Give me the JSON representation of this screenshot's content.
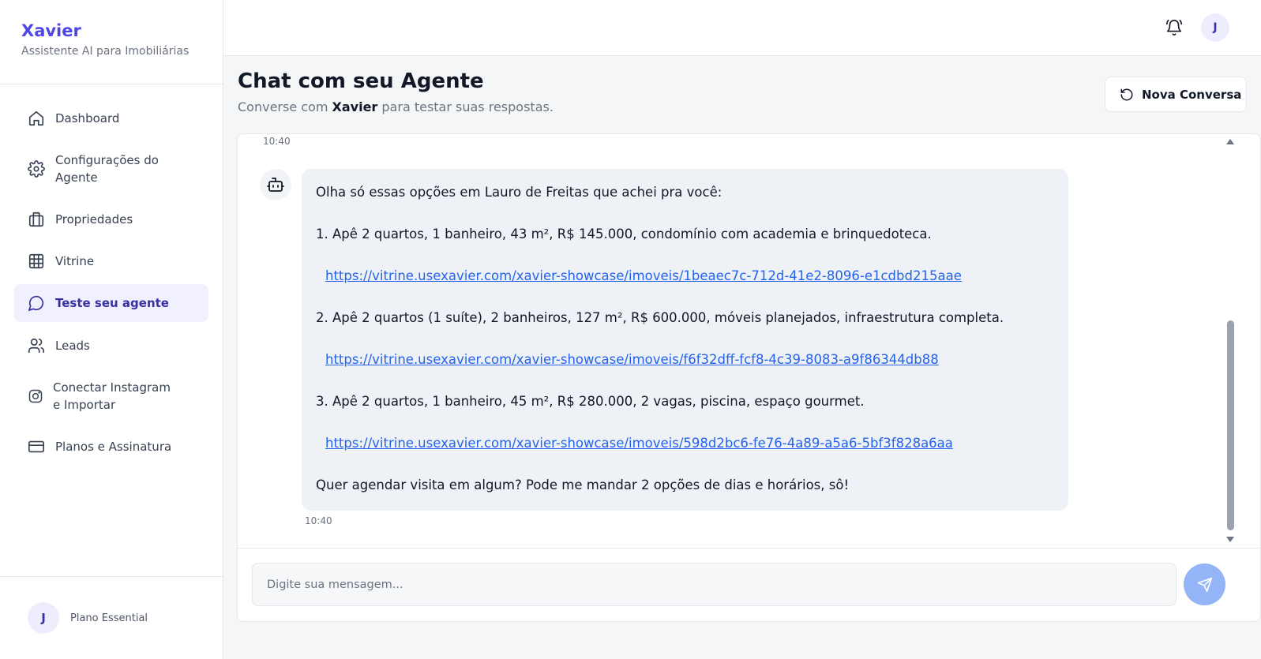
{
  "brand": {
    "name": "Xavier",
    "subtitle": "Assistente AI para Imobiliárias"
  },
  "sidebar": {
    "items": [
      {
        "label": "Dashboard",
        "icon": "home-icon"
      },
      {
        "label": "Configurações do Agente",
        "icon": "gear-icon"
      },
      {
        "label": "Propriedades",
        "icon": "building-icon"
      },
      {
        "label": "Vitrine",
        "icon": "grid-icon"
      },
      {
        "label": "Teste seu agente",
        "icon": "chat-bubble-icon",
        "active": true
      },
      {
        "label": "Leads",
        "icon": "users-icon"
      },
      {
        "label": "Conectar Instagram e Importar",
        "icon": "instagram-icon"
      },
      {
        "label": "Planos e Assinatura",
        "icon": "credit-card-icon"
      }
    ],
    "footer": {
      "avatar_initial": "J",
      "plan": "Plano Essential"
    }
  },
  "topbar": {
    "avatar_initial": "J"
  },
  "header": {
    "title": "Chat com seu Agente",
    "subtitle_prefix": "Converse com ",
    "subtitle_agent": "Xavier",
    "subtitle_suffix": " para testar suas respostas.",
    "new_chat_label": "Nova Conversa"
  },
  "chat": {
    "prev_timestamp": "10:40",
    "message": {
      "intro": "Olha só essas opções em Lauro de Freitas que achei pra você:",
      "options": [
        {
          "text": "1. Apê 2 quartos, 1 banheiro, 43 m², R$ 145.000, condomínio com academia e brinquedoteca.",
          "link": "https://vitrine.usexavier.com/xavier-showcase/imoveis/1beaec7c-712d-41e2-8096-e1cdbd215aae"
        },
        {
          "text": "2. Apê 2 quartos (1 suíte), 2 banheiros, 127 m², R$ 600.000, móveis planejados, infraestrutura completa.",
          "link": "https://vitrine.usexavier.com/xavier-showcase/imoveis/f6f32dff-fcf8-4c39-8083-a9f86344db88"
        },
        {
          "text": "3. Apê 2 quartos, 1 banheiro, 45 m², R$ 280.000, 2 vagas, piscina, espaço gourmet.",
          "link": "https://vitrine.usexavier.com/xavier-showcase/imoveis/598d2bc6-fe76-4a89-a5a6-5bf3f828a6aa"
        }
      ],
      "closing": "Quer agendar visita em algum? Pode me mandar 2 opções de dias e horários, sô!",
      "timestamp": "10:40"
    },
    "input_placeholder": "Digite sua mensagem..."
  },
  "colors": {
    "accent": "#4f46e5",
    "active_bg": "#f1f0fe",
    "link": "#2563eb",
    "send_button": "#93b4f7",
    "bubble_bg": "#eef1f6"
  }
}
